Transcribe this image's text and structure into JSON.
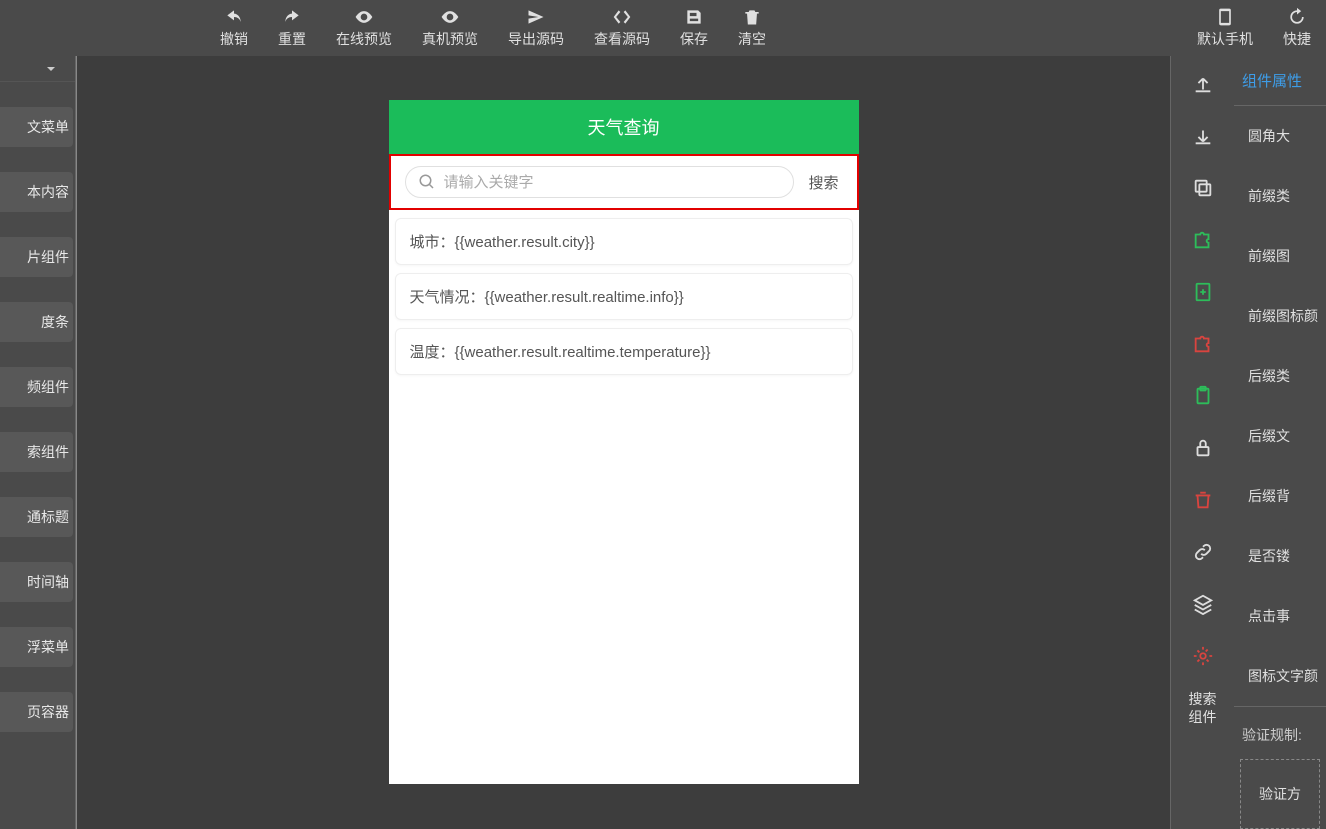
{
  "toolbar": {
    "items": [
      {
        "label": "撤销",
        "icon": "undo"
      },
      {
        "label": "重置",
        "icon": "redo"
      },
      {
        "label": "在线预览",
        "icon": "eye"
      },
      {
        "label": "真机预览",
        "icon": "eye"
      },
      {
        "label": "导出源码",
        "icon": "send"
      },
      {
        "label": "查看源码",
        "icon": "code"
      },
      {
        "label": "保存",
        "icon": "save"
      },
      {
        "label": "清空",
        "icon": "delete"
      }
    ],
    "right": [
      {
        "label": "默认手机",
        "icon": "phone"
      },
      {
        "label": "快捷",
        "icon": "refresh"
      }
    ]
  },
  "leftSidebar": {
    "components": [
      "文菜单",
      "本内容",
      "片组件",
      "度条",
      "频组件",
      "索组件",
      "通标题",
      "时间轴",
      "浮菜单",
      "页容器"
    ]
  },
  "preview": {
    "title": "天气查询",
    "search": {
      "placeholder": "请输入关键字",
      "buttonLabel": "搜索"
    },
    "cards": [
      "城市：{{weather.result.city}}",
      "天气情况：{{weather.result.realtime.info}}",
      "温度：{{weather.result.realtime.temperature}}"
    ]
  },
  "rail": {
    "bottomLabel": "搜索\n组件"
  },
  "props": {
    "tabLabel": "组件属性",
    "rows": [
      "圆角大",
      "前缀类",
      "前缀图",
      "前缀图标颜",
      "后缀类",
      "后缀文",
      "后缀背",
      "是否镂",
      "点击事",
      "图标文字颜"
    ],
    "sectionLabel": "验证规制:",
    "validateLabel": "验证方"
  }
}
